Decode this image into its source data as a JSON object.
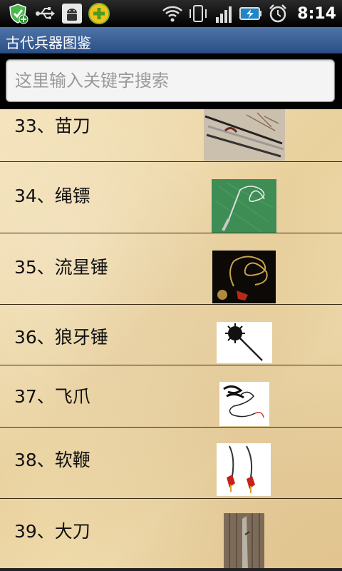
{
  "status_bar": {
    "time": "8:14",
    "icons": [
      "shield-add-icon",
      "usb-icon",
      "android-debug-icon",
      "app-plus-icon",
      "wifi-icon",
      "vibrate-icon",
      "signal-icon",
      "battery-charging-icon",
      "alarm-icon"
    ]
  },
  "app": {
    "title": "古代兵器图鉴"
  },
  "search": {
    "placeholder": "这里输入关键字搜索",
    "value": ""
  },
  "items": [
    {
      "label": "33、苗刀",
      "image": "miao-dao-thumbnail"
    },
    {
      "label": "34、绳镖",
      "image": "rope-dart-thumbnail"
    },
    {
      "label": "35、流星锤",
      "image": "meteor-hammer-thumbnail"
    },
    {
      "label": "36、狼牙锤",
      "image": "spiked-mace-thumbnail"
    },
    {
      "label": "37、飞爪",
      "image": "flying-claw-thumbnail"
    },
    {
      "label": "38、软鞭",
      "image": "soft-whip-thumbnail"
    },
    {
      "label": "39、大刀",
      "image": "great-saber-thumbnail"
    }
  ],
  "colors": {
    "title_bar": "#3a5f96",
    "list_background": "#efd9a9",
    "divider": "#3a2a14"
  }
}
